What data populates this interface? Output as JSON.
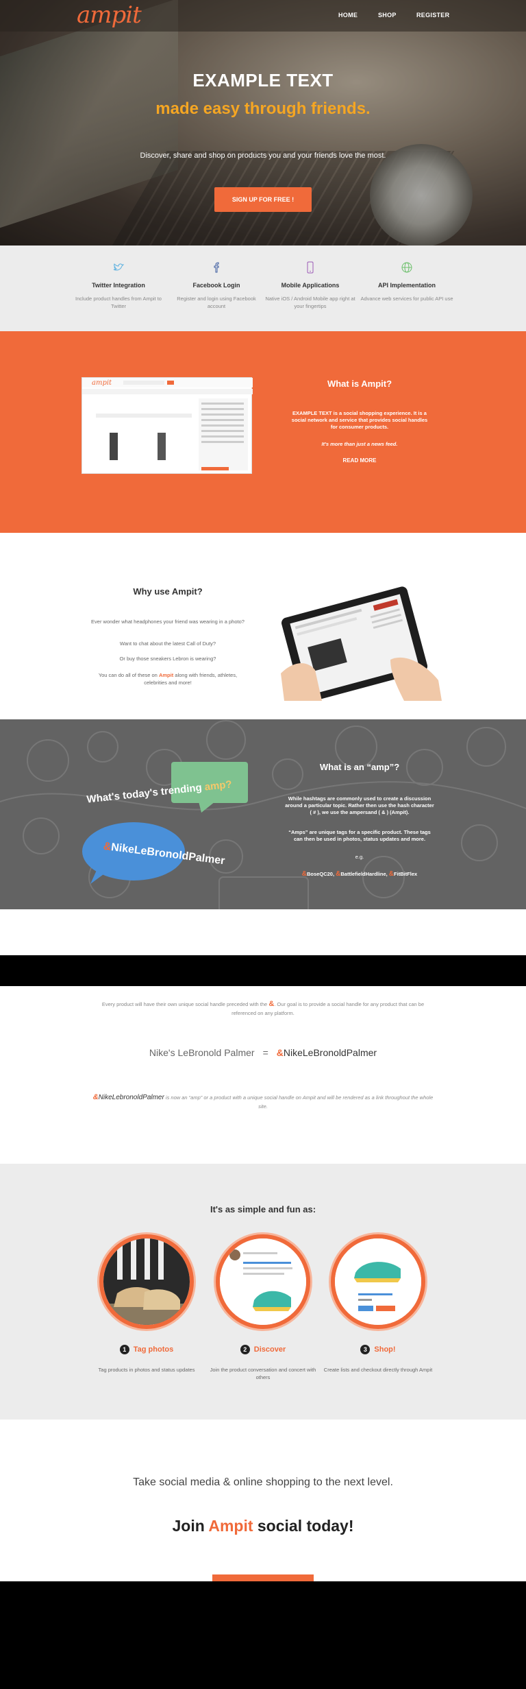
{
  "brand": {
    "logo_text": "amp",
    "logo_accent": "it",
    "accent_color": "#f06a3a",
    "highlight_color": "#f5a623"
  },
  "nav": {
    "items": [
      {
        "label": "HOME"
      },
      {
        "label": "SHOP"
      },
      {
        "label": "REGISTER"
      }
    ]
  },
  "hero": {
    "title": "EXAMPLE TEXT",
    "subtitle": "made easy through friends.",
    "tagline": "Discover, share and shop on products you and your friends love the most.",
    "cta": "SIGN UP FOR FREE !"
  },
  "features": [
    {
      "icon": "twitter-icon",
      "title": "Twitter Integration",
      "desc": "Include product handles from Ampit to Twitter"
    },
    {
      "icon": "facebook-icon",
      "title": "Facebook Login",
      "desc": "Register and login using Facebook account"
    },
    {
      "icon": "mobile-icon",
      "title": "Mobile Applications",
      "desc": "Native iOS / Android Mobile app right at your fingertips"
    },
    {
      "icon": "globe-icon",
      "title": "API Implementation",
      "desc": "Advance web services for public API use"
    }
  ],
  "what_is": {
    "title": "What is Ampit?",
    "body_highlight": "EXAMPLE TEXT",
    "body": " is a social shopping experience. It is a social network and service that provides social handles for consumer products.",
    "quote": "It's more than just a news feed.",
    "read_more": "READ MORE"
  },
  "why": {
    "title": "Why use Ampit?",
    "lines": [
      "Ever wonder what headphones your friend was wearing in a photo?",
      "Want to chat about the latest Call of Duty?",
      "Or buy those sneakers Lebron is wearing?"
    ],
    "last_prefix": "You can do all of these on ",
    "last_brand": "Ampit",
    "last_suffix": " along with friends, athletes, celebrities and more!"
  },
  "amp_section": {
    "trending_prefix": "What's today's ",
    "trending_word": "trending",
    "trending_amp": "amp?",
    "bubble_amp": "&",
    "bubble_tag": "NikeLeBronoldPalmer",
    "title": "What is an “amp”?",
    "body1": "While hashtags are commonly used to create a discussion around a particular topic. Rather then use the hash character ( # ), we use the ampersand ( & ) (Ampit).",
    "body2": "“Amps” are unique tags for a specific product. These tags can then be used in photos, status updates and more.",
    "eg": "e.g.",
    "tags": [
      "BoseQC20",
      "BattlefieldHardline",
      "FitBitFlex"
    ]
  },
  "handle": {
    "intro_before": "Every product will have their own unique social handle preceded with the ",
    "intro_amp": "&",
    "intro_after": ". Our goal is to provide a social handle for any product that can be referenced on any platform.",
    "example_name": "Nike's LeBronold Palmer",
    "example_eq": "=",
    "example_amp": "&",
    "example_tag": "NikeLeBronoldPalmer",
    "note_amp": "&",
    "note_tag": "NikeLebronoldPalmer",
    "note_text": " is now an “amp” or a product with a unique social handle on Ampit and will be rendered as a link throughout the whole site."
  },
  "simple": {
    "title": "It's as simple and fun as:",
    "steps": [
      {
        "num": "1",
        "title": "Tag photos",
        "desc": "Tag products in photos and status updates"
      },
      {
        "num": "2",
        "title": "Discover",
        "desc": "Join the product conversation and concert with others"
      },
      {
        "num": "3",
        "title": "Shop!",
        "desc": "Create lists and checkout directly through Ampit"
      }
    ]
  },
  "join": {
    "tagline": "Take social media & online shopping to the next level.",
    "title_prefix": "Join ",
    "title_brand": "Ampit",
    "title_suffix": " social today!"
  }
}
